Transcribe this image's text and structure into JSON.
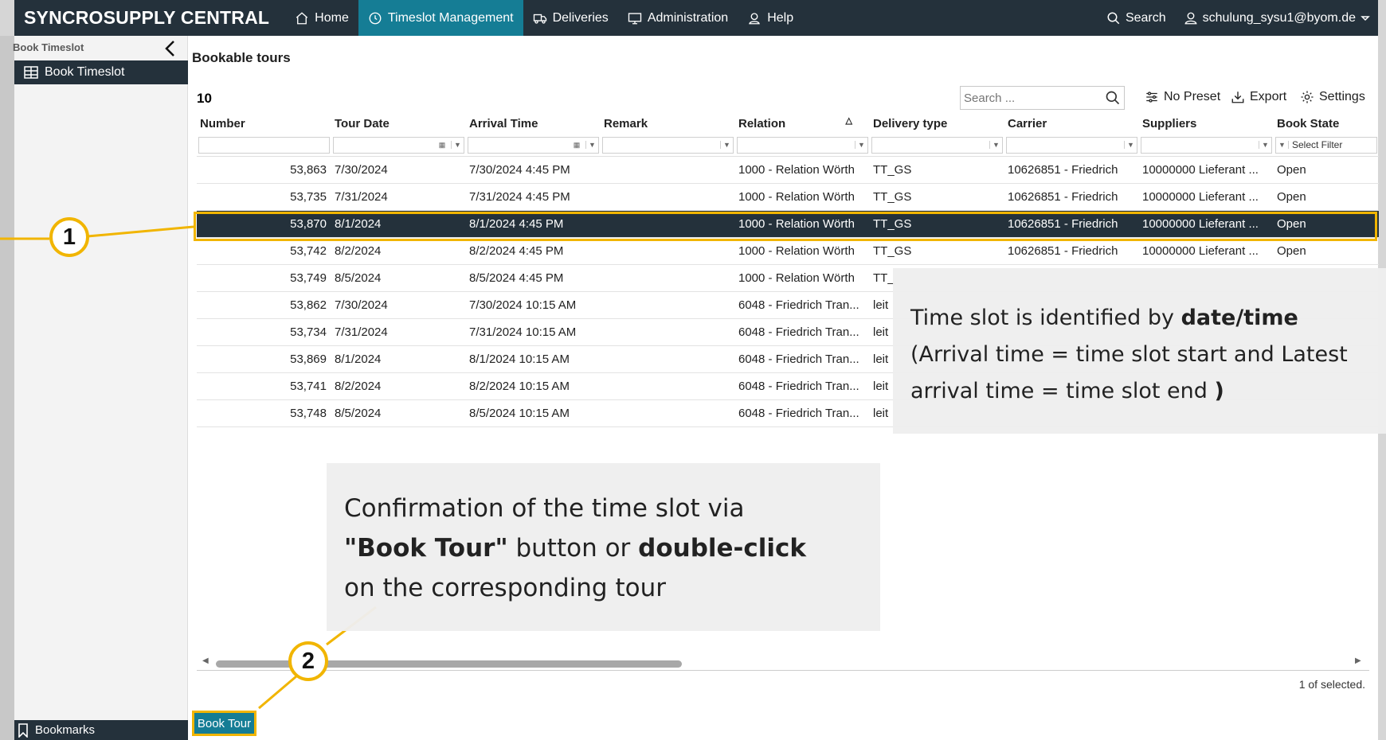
{
  "app": {
    "brand": "SYNCROSUPPLY CENTRAL",
    "nav": [
      {
        "label": "Home",
        "icon": "home-icon"
      },
      {
        "label": "Timeslot Management",
        "icon": "clock-icon",
        "active": true
      },
      {
        "label": "Deliveries",
        "icon": "truck-icon"
      },
      {
        "label": "Administration",
        "icon": "monitor-icon"
      },
      {
        "label": "Help",
        "icon": "help-person-icon"
      }
    ],
    "search_label": "Search",
    "user": "schulung_sysu1@byom.de"
  },
  "sidebar": {
    "title": "Book Timeslot",
    "item": "Book Timeslot",
    "bookmarks": "Bookmarks"
  },
  "main": {
    "title": "Bookable tours",
    "count": "10",
    "search_placeholder": "Search ...",
    "toolbar": {
      "preset": "No Preset",
      "export": "Export",
      "settings": "Settings"
    },
    "filter_placeholder": "Select Filter",
    "columns": [
      "Number",
      "Tour Date",
      "Arrival Time",
      "Remark",
      "Relation",
      "Delivery type",
      "Carrier",
      "Suppliers",
      "Book State"
    ],
    "rows": [
      {
        "number": "53,863",
        "tour_date": "7/30/2024",
        "arrival": "7/30/2024 4:45 PM",
        "remark": "",
        "relation": "1000 - Relation Wörth",
        "delivery": "TT_GS",
        "carrier": "10626851 - Friedrich",
        "suppliers": "10000000 Lieferant ...",
        "state": "Open"
      },
      {
        "number": "53,735",
        "tour_date": "7/31/2024",
        "arrival": "7/31/2024 4:45 PM",
        "remark": "",
        "relation": "1000 - Relation Wörth",
        "delivery": "TT_GS",
        "carrier": "10626851 - Friedrich",
        "suppliers": "10000000 Lieferant ...",
        "state": "Open"
      },
      {
        "number": "53,870",
        "tour_date": "8/1/2024",
        "arrival": "8/1/2024 4:45 PM",
        "remark": "",
        "relation": "1000 - Relation Wörth",
        "delivery": "TT_GS",
        "carrier": "10626851 - Friedrich",
        "suppliers": "10000000 Lieferant ...",
        "state": "Open",
        "selected": true
      },
      {
        "number": "53,742",
        "tour_date": "8/2/2024",
        "arrival": "8/2/2024 4:45 PM",
        "remark": "",
        "relation": "1000 - Relation Wörth",
        "delivery": "TT_GS",
        "carrier": "10626851 - Friedrich",
        "suppliers": "10000000 Lieferant ...",
        "state": "Open"
      },
      {
        "number": "53,749",
        "tour_date": "8/5/2024",
        "arrival": "8/5/2024 4:45 PM",
        "remark": "",
        "relation": "1000 - Relation Wörth",
        "delivery": "TT_",
        "carrier": "",
        "suppliers": "",
        "state": ""
      },
      {
        "number": "53,862",
        "tour_date": "7/30/2024",
        "arrival": "7/30/2024 10:15 AM",
        "remark": "",
        "relation": "6048 - Friedrich Tran...",
        "delivery": "leit",
        "carrier": "",
        "suppliers": "",
        "state": ""
      },
      {
        "number": "53,734",
        "tour_date": "7/31/2024",
        "arrival": "7/31/2024 10:15 AM",
        "remark": "",
        "relation": "6048 - Friedrich Tran...",
        "delivery": "leit",
        "carrier": "",
        "suppliers": "",
        "state": ""
      },
      {
        "number": "53,869",
        "tour_date": "8/1/2024",
        "arrival": "8/1/2024 10:15 AM",
        "remark": "",
        "relation": "6048 - Friedrich Tran...",
        "delivery": "leit",
        "carrier": "",
        "suppliers": "",
        "state": ""
      },
      {
        "number": "53,741",
        "tour_date": "8/2/2024",
        "arrival": "8/2/2024 10:15 AM",
        "remark": "",
        "relation": "6048 - Friedrich Tran...",
        "delivery": "leit",
        "carrier": "",
        "suppliers": "",
        "state": ""
      },
      {
        "number": "53,748",
        "tour_date": "8/5/2024",
        "arrival": "8/5/2024 10:15 AM",
        "remark": "",
        "relation": "6048 - Friedrich Tran...",
        "delivery": "leit",
        "carrier": "",
        "suppliers": "",
        "state": ""
      }
    ],
    "selected_info": "1 of selected.",
    "book_button": "Book Tour"
  },
  "annotations": {
    "badge1": "1",
    "badge2": "2",
    "callout1": {
      "line1a": "Time slot is identified by ",
      "line1b": "date/time",
      "line2": "(Arrival time = time slot start and Latest",
      "line3a": "arrival time = time slot end ",
      "line3b": ")"
    },
    "callout2": {
      "line1": "Confirmation of the time slot via",
      "line2a": "\"Book Tour\"",
      "line2b": " button or ",
      "line2c": "double-click",
      "line3": "on the corresponding tour"
    },
    "accent_color": "#f1b500"
  }
}
